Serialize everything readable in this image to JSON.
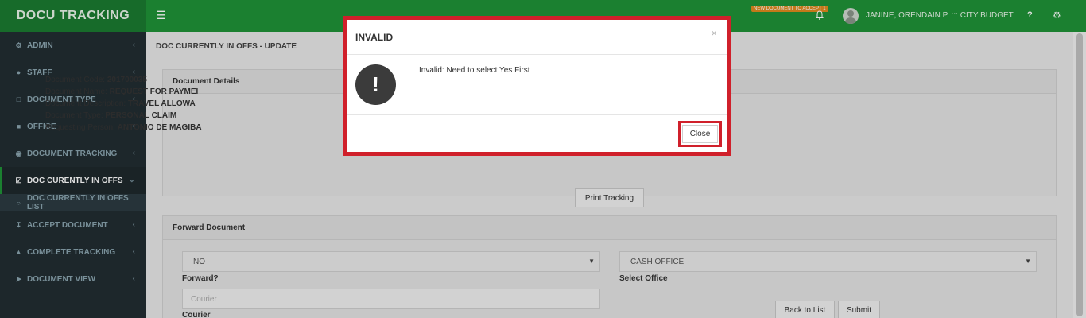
{
  "app": {
    "logo": "DOCU TRACKING"
  },
  "header": {
    "notification_badge": "NEW DOCUMENT TO ACCEPT 1",
    "user_name": "JANINE, ORENDAIN P. ::: CITY BUDGET",
    "help": "?"
  },
  "sidebar": {
    "items": [
      {
        "label": "ADMIN",
        "icon": "gear-icon"
      },
      {
        "label": "STAFF",
        "icon": "user-icon"
      },
      {
        "label": "DOCUMENT TYPE",
        "icon": "folder-icon"
      },
      {
        "label": "OFFICE",
        "icon": "building-icon"
      },
      {
        "label": "DOCUMENT TRACKING",
        "icon": "compass-icon"
      },
      {
        "label": "DOC CURENTLY IN OFFS",
        "icon": "checkbox-icon"
      },
      {
        "label": "DOC CURRENTLY IN OFFS LIST",
        "icon": "circle-icon"
      },
      {
        "label": "ACCEPT DOCUMENT",
        "icon": "download-icon"
      },
      {
        "label": "COMPLETE TRACKING",
        "icon": "thumbs-up-icon"
      },
      {
        "label": "DOCUMENT VIEW",
        "icon": "send-icon"
      }
    ]
  },
  "main": {
    "page_title": "DOC CURRENTLY IN OFFS - UPDATE",
    "document_details": {
      "heading": "Document Details",
      "rows": [
        {
          "label": "Document Code:",
          "value": "201700035"
        },
        {
          "label": "Document Name:",
          "value": "REQUEST FOR PAYMEI"
        },
        {
          "label": "Document Description:",
          "value": "TRAVEL ALLOWA"
        },
        {
          "label": "Document Type:",
          "value": "PERSONAL CLAIM"
        },
        {
          "label": "Requesting Person:",
          "value": "ANTONIO DE MAGIBA"
        }
      ],
      "print_button": "Print Tracking"
    },
    "forward_document": {
      "heading": "Forward Document",
      "forward_select_value": "NO",
      "forward_label": "Forward?",
      "office_select_value": "CASH OFFICE",
      "office_label": "Select Office",
      "courier_placeholder": "Courier",
      "courier_label": "Courier",
      "back_button": "Back to List",
      "submit_button": "Submit"
    }
  },
  "modal": {
    "title": "INVALID",
    "close_x": "×",
    "icon_glyph": "!",
    "message": "Invalid: Need to select Yes First",
    "close_button": "Close",
    "highlight_color": "#d0202b"
  },
  "colors": {
    "header_green": "#1f9237",
    "logo_green": "#1b7a30",
    "sidebar_bg": "#222d32"
  }
}
